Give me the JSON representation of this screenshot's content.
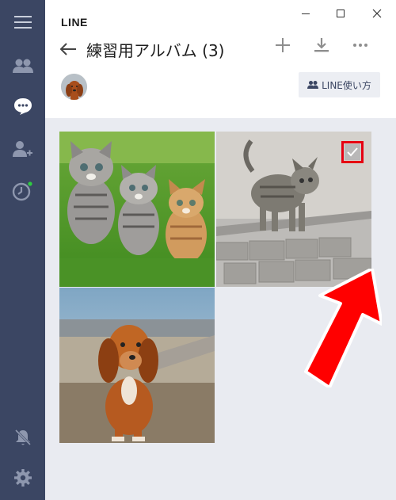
{
  "app": {
    "name": "LINE"
  },
  "window": {
    "minimize": "minimize",
    "maximize": "maximize",
    "close": "close"
  },
  "sidebar": {
    "items": [
      {
        "icon": "menu-icon"
      },
      {
        "icon": "friends-icon"
      },
      {
        "icon": "chat-icon"
      },
      {
        "icon": "add-friend-icon"
      },
      {
        "icon": "timeline-icon"
      },
      {
        "icon": "notification-off-icon"
      },
      {
        "icon": "settings-icon"
      }
    ]
  },
  "header": {
    "title": "練習用アルバム (3)",
    "help_label": "LINE使い方"
  },
  "album": {
    "photos": [
      {
        "subject": "kittens",
        "selected": false
      },
      {
        "subject": "kitten-walking",
        "selected": true
      },
      {
        "subject": "puppy",
        "selected": false
      }
    ]
  },
  "colors": {
    "sidebar": "#3b4663",
    "gallery_bg": "#e9ebf1",
    "highlight": "#e60012",
    "badge": "#2ecc40"
  }
}
